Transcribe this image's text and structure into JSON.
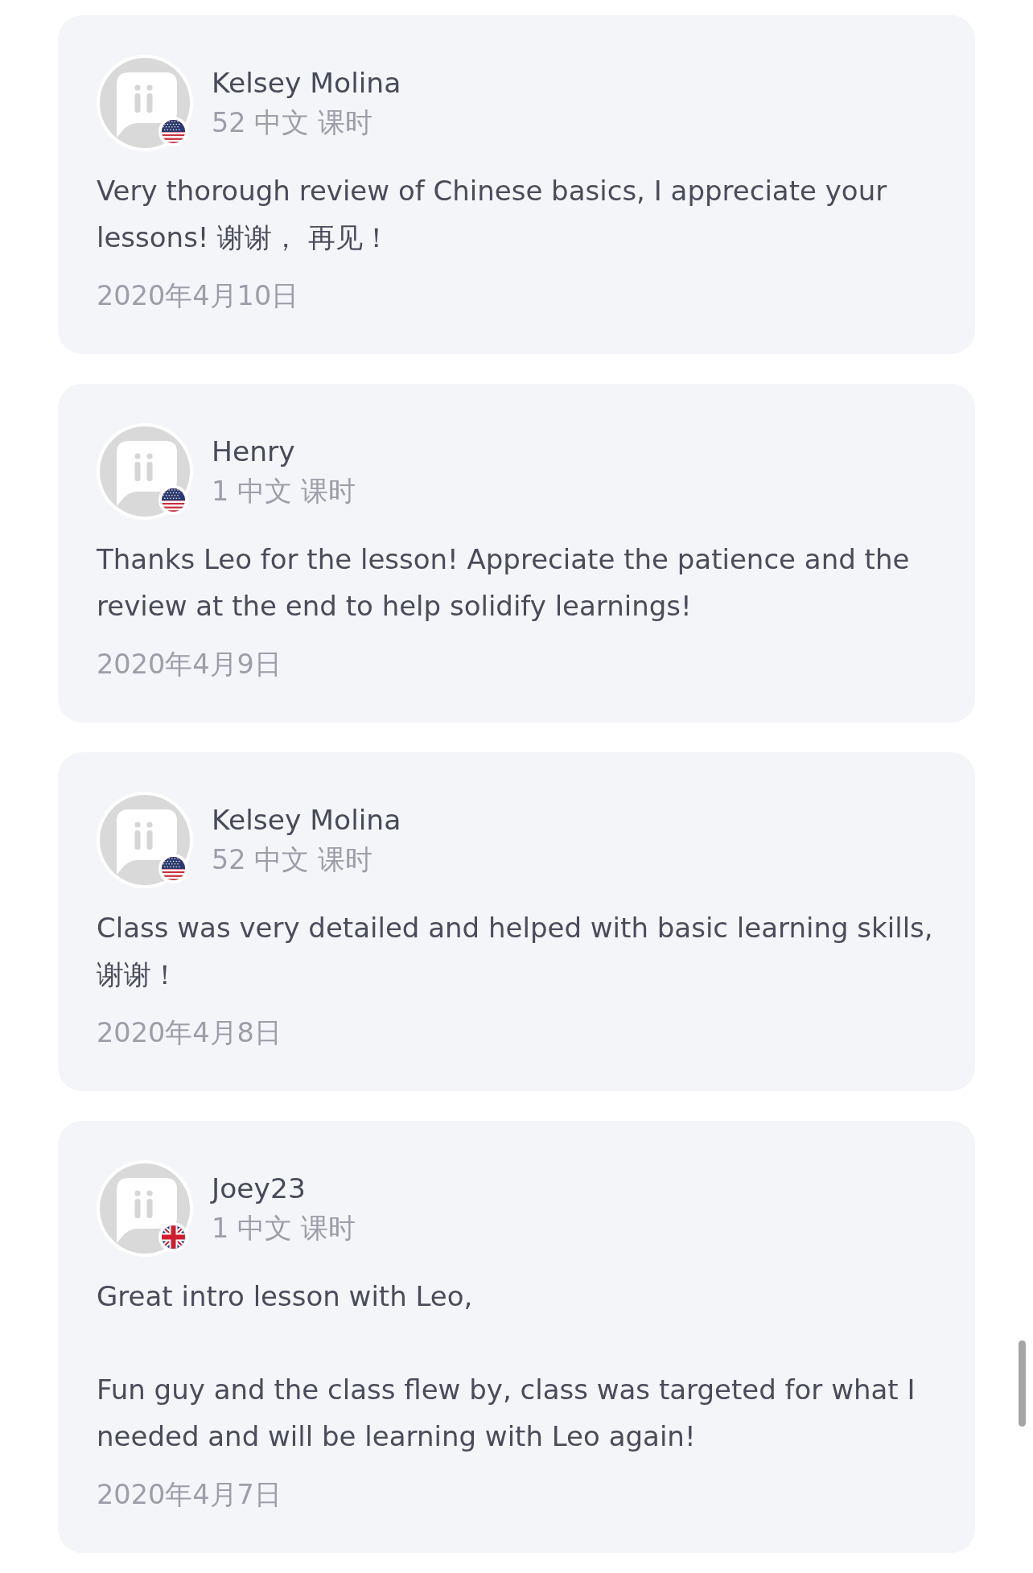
{
  "reviews": [
    {
      "reviewer": {
        "name": "Kelsey Molina",
        "flag": {
          "kind": "us"
        }
      },
      "lessons": "52 中文 课时",
      "comment": "Very thorough review of Chinese basics, I appreciate your lessons! 谢谢， 再见！",
      "date": "2020年4月10日"
    },
    {
      "reviewer": {
        "name": "Henry",
        "flag": {
          "kind": "us"
        }
      },
      "lessons": "1 中文 课时",
      "comment": "Thanks Leo for the lesson! Appreciate the patience and the review at the end to help solidify learnings!",
      "date": "2020年4月9日"
    },
    {
      "reviewer": {
        "name": "Kelsey Molina",
        "flag": {
          "kind": "us"
        }
      },
      "lessons": "52 中文 课时",
      "comment": "Class was very detailed and helped with basic learning skills, 谢谢！",
      "date": "2020年4月8日"
    },
    {
      "reviewer": {
        "name": "Joey23",
        "flag": {
          "kind": "gb"
        }
      },
      "lessons": "1 中文 课时",
      "comment": "Great intro lesson with Leo,\n\nFun guy and the class flew by, class was targeted for what I needed and will be learning with Leo again!",
      "date": "2020年4月7日"
    }
  ]
}
